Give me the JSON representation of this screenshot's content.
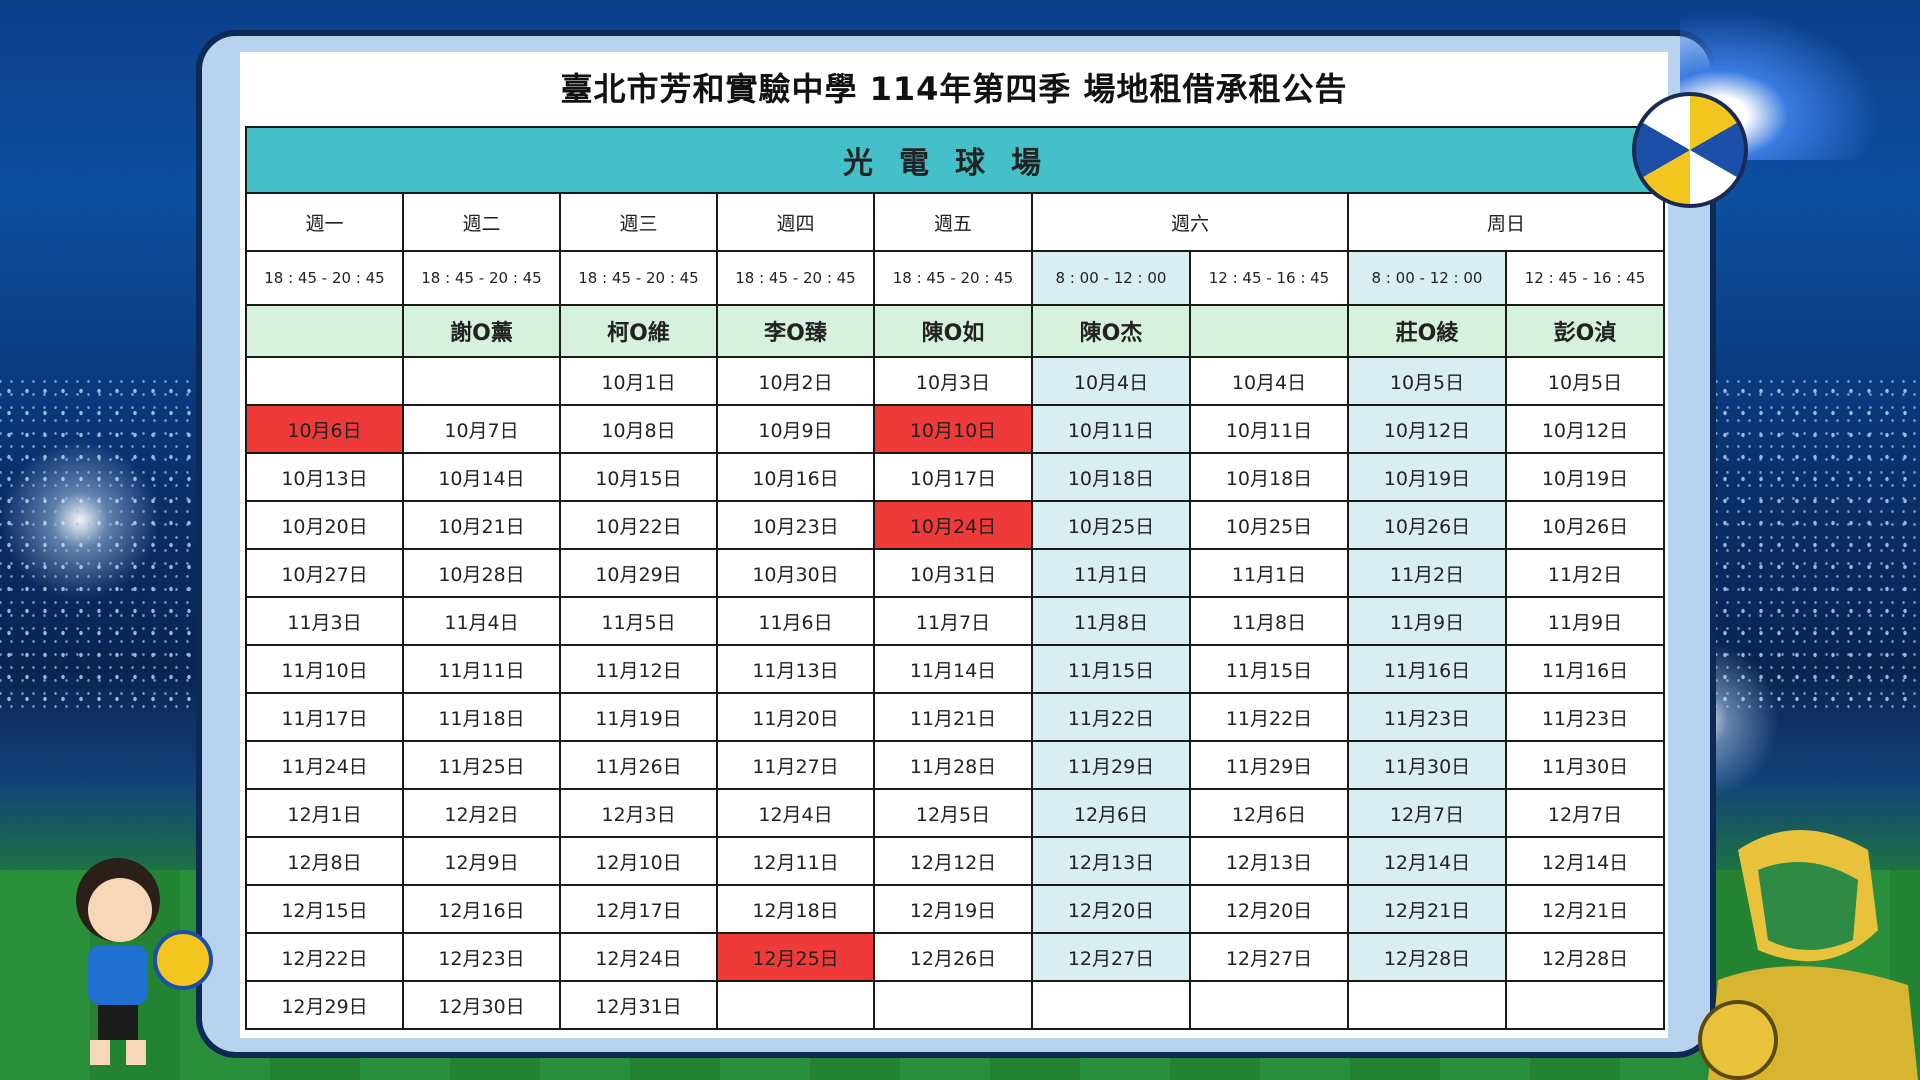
{
  "title": "臺北市芳和實驗中學 114年第四季 場地租借承租公告",
  "venue": "光電球場",
  "days": [
    "週一",
    "週二",
    "週三",
    "週四",
    "週五",
    "週六",
    "周日"
  ],
  "time_slots": [
    "18 : 45 - 20 : 45",
    "18 : 45 - 20 : 45",
    "18 : 45 - 20 : 45",
    "18 : 45 - 20 : 45",
    "18 : 45 - 20 : 45",
    "8 : 00 - 12 : 00",
    "12 : 45 - 16 : 45",
    "8 : 00 - 12 : 00",
    "12 : 45 - 16 : 45"
  ],
  "renters": [
    "",
    "謝O薰",
    "柯O維",
    "李O臻",
    "陳O如",
    "陳O杰",
    "",
    "莊O綾",
    "彭O湞"
  ],
  "date_rows": [
    [
      "",
      "",
      "10月1日",
      "10月2日",
      "10月3日",
      "10月4日",
      "10月4日",
      "10月5日",
      "10月5日"
    ],
    [
      "10月6日",
      "10月7日",
      "10月8日",
      "10月9日",
      "10月10日",
      "10月11日",
      "10月11日",
      "10月12日",
      "10月12日"
    ],
    [
      "10月13日",
      "10月14日",
      "10月15日",
      "10月16日",
      "10月17日",
      "10月18日",
      "10月18日",
      "10月19日",
      "10月19日"
    ],
    [
      "10月20日",
      "10月21日",
      "10月22日",
      "10月23日",
      "10月24日",
      "10月25日",
      "10月25日",
      "10月26日",
      "10月26日"
    ],
    [
      "10月27日",
      "10月28日",
      "10月29日",
      "10月30日",
      "10月31日",
      "11月1日",
      "11月1日",
      "11月2日",
      "11月2日"
    ],
    [
      "11月3日",
      "11月4日",
      "11月5日",
      "11月6日",
      "11月7日",
      "11月8日",
      "11月8日",
      "11月9日",
      "11月9日"
    ],
    [
      "11月10日",
      "11月11日",
      "11月12日",
      "11月13日",
      "11月14日",
      "11月15日",
      "11月15日",
      "11月16日",
      "11月16日"
    ],
    [
      "11月17日",
      "11月18日",
      "11月19日",
      "11月20日",
      "11月21日",
      "11月22日",
      "11月22日",
      "11月23日",
      "11月23日"
    ],
    [
      "11月24日",
      "11月25日",
      "11月26日",
      "11月27日",
      "11月28日",
      "11月29日",
      "11月29日",
      "11月30日",
      "11月30日"
    ],
    [
      "12月1日",
      "12月2日",
      "12月3日",
      "12月4日",
      "12月5日",
      "12月6日",
      "12月6日",
      "12月7日",
      "12月7日"
    ],
    [
      "12月8日",
      "12月9日",
      "12月10日",
      "12月11日",
      "12月12日",
      "12月13日",
      "12月13日",
      "12月14日",
      "12月14日"
    ],
    [
      "12月15日",
      "12月16日",
      "12月17日",
      "12月18日",
      "12月19日",
      "12月20日",
      "12月20日",
      "12月21日",
      "12月21日"
    ],
    [
      "12月22日",
      "12月23日",
      "12月24日",
      "12月25日",
      "12月26日",
      "12月27日",
      "12月27日",
      "12月28日",
      "12月28日"
    ],
    [
      "12月29日",
      "12月30日",
      "12月31日",
      "",
      "",
      "",
      "",
      "",
      ""
    ]
  ],
  "highlighted_dates": [
    "10月6日",
    "10月10日",
    "10月24日",
    "12月25日"
  ],
  "colors": {
    "venue_header": "#46c0c8",
    "renter_row": "#d7f1df",
    "weekend_cells": "#d9eef0",
    "highlight_red": "#ef3a3a",
    "board_border": "#0d2a55"
  },
  "decorations": [
    "volleyball-icon",
    "flame-icon",
    "volleyball-player-illustration",
    "soccer-player-illustration",
    "stadium-lights"
  ]
}
